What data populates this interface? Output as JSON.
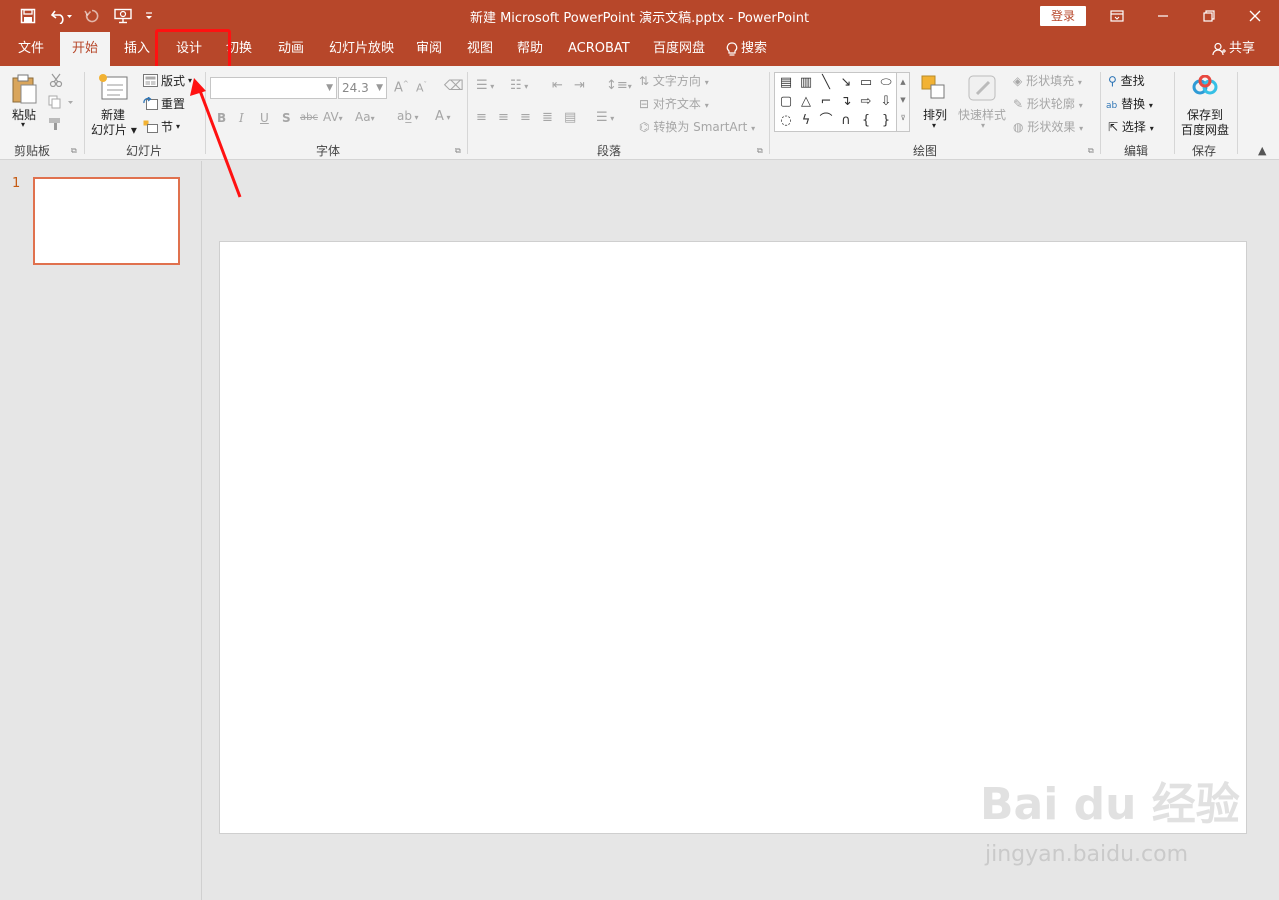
{
  "titlebar": {
    "title": "新建 Microsoft PowerPoint 演示文稿.pptx  -  PowerPoint",
    "login": "登录",
    "qa_icons": [
      "save-icon",
      "undo-icon",
      "redo-icon",
      "present-icon",
      "customize-icon"
    ]
  },
  "tabs": {
    "file": "文件",
    "home": "开始",
    "insert": "插入",
    "design": "设计",
    "transitions": "切换",
    "animations": "动画",
    "slideshow": "幻灯片放映",
    "review": "审阅",
    "view": "视图",
    "help": "帮助",
    "acrobat": "ACROBAT",
    "baidu": "百度网盘",
    "search": "搜索",
    "share": "共享"
  },
  "ribbon": {
    "clipboard": {
      "paste": "粘贴",
      "label": "剪贴板"
    },
    "slides": {
      "new_slide_1": "新建",
      "new_slide_2": "幻灯片",
      "layout": "版式",
      "reset": "重置",
      "section": "节",
      "label": "幻灯片"
    },
    "font": {
      "font_name": "",
      "font_size": "24.3",
      "label": "字体"
    },
    "paragraph": {
      "text_direction": "文字方向",
      "align_text": "对齐文本",
      "smartart": "转换为 SmartArt",
      "label": "段落"
    },
    "drawing": {
      "arrange": "排列",
      "quick_styles": "快速样式",
      "shape_fill": "形状填充",
      "shape_outline": "形状轮廓",
      "shape_effects": "形状效果",
      "label": "绘图"
    },
    "editing": {
      "find": "查找",
      "replace": "替换",
      "select": "选择",
      "label": "编辑"
    },
    "save": {
      "save_to_1": "保存到",
      "save_to_2": "百度网盘",
      "label": "保存"
    }
  },
  "slides_pane": {
    "slide_number": "1"
  },
  "watermark": {
    "logo": "Bai du 经验",
    "url": "jingyan.baidu.com"
  },
  "colors": {
    "accent": "#b7472a",
    "highlight": "#ff1111"
  }
}
